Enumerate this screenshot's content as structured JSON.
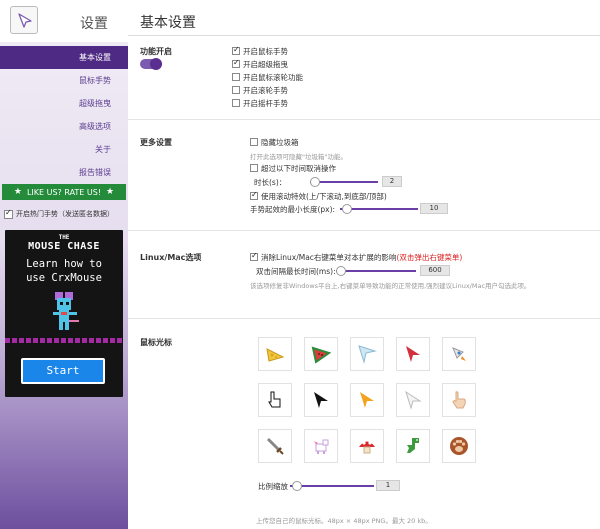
{
  "sidebar": {
    "title": "设置",
    "nav": [
      "基本设置",
      "鼠标手势",
      "超级拖曳",
      "高级选项",
      "关于",
      "报告错误"
    ],
    "rate_label": "LIKE US? RATE US!",
    "hot_gesture": "开启热门手势（发送匿名数据）",
    "promo": {
      "the": "THE",
      "title": "MOUSE CHASE",
      "line1": "Learn how to",
      "line2": "use CrxMouse",
      "start": "Start"
    }
  },
  "main": {
    "title": "基本设置",
    "enable": {
      "title": "功能开启",
      "options": [
        {
          "label": "开启鼠标手势",
          "checked": true
        },
        {
          "label": "开启超级拖曳",
          "checked": true
        },
        {
          "label": "开启鼠标滚轮功能",
          "checked": false
        },
        {
          "label": "开启滚轮手势",
          "checked": false
        },
        {
          "label": "开启摇杆手势",
          "checked": false
        }
      ]
    },
    "more": {
      "title": "更多设置",
      "hide_trash": "隐藏垃圾箱",
      "hide_trash_hint": "打开此选项可隐藏\"垃圾箱\"功能。",
      "timeout": "超过以下时间取消操作",
      "duration_label": "时长(s)：",
      "duration_value": "2",
      "scroll_effect": "使用滚动特效(上/下滚动,到底部/顶部)",
      "min_len_label": "手势起效的最小长度(px):",
      "min_len_value": "10"
    },
    "linux": {
      "title": "Linux/Mac选项",
      "fix_label": "消除Linux/Mac右键菜单对本扩展的影响",
      "fix_red": "(双击弹出右键菜单)",
      "interval_label": "双击间隔最长时间(ms):",
      "interval_value": "600",
      "hint": "该选项修复非Windows平台上,右键菜单导致功能的正常使用,强烈建议Linux/Mac用户勾选此项。"
    },
    "cursor": {
      "title": "鼠标光标",
      "icons": [
        "cheese-cursor-icon",
        "watermelon-cursor-icon",
        "paper-plane-cursor-icon",
        "red-arrow-cursor-icon",
        "rocket-cursor-icon",
        "pixel-hand-cursor-icon",
        "black-arrow-cursor-icon",
        "orange-arrow-cursor-icon",
        "white-arrow-cursor-icon",
        "hand-cursor-icon",
        "sword-cursor-icon",
        "unicorn-cursor-icon",
        "mushroom-cursor-icon",
        "dinosaur-cursor-icon",
        "paw-cursor-icon"
      ],
      "scale_label": "比例缩放",
      "scale_value": "1",
      "upload_hint": "上传您自己的鼠标光标。48px × 48px PNG。最大 20 kb。"
    }
  },
  "colors": {
    "accent": "#4f2a84",
    "green": "#238b3a",
    "red": "#d22222",
    "start_blue": "#1a86ea"
  }
}
